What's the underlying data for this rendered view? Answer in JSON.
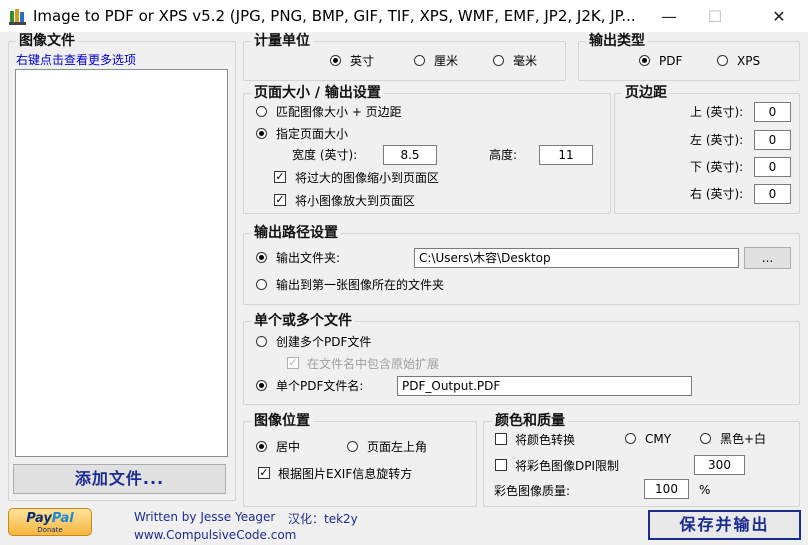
{
  "window": {
    "title": "Image to PDF or XPS  v5.2   (JPG, PNG, BMP, GIF, TIF, XPS, WMF, EMF, JP2, J2K, JP...",
    "minimize_glyph": "—",
    "maximize_glyph": "☐",
    "close_glyph": "✕"
  },
  "files": {
    "title": "图像文件",
    "hint": "右键点击查看更多选项",
    "add_button": "添加文件..."
  },
  "units": {
    "title": "计量单位",
    "options": [
      "英寸",
      "厘米",
      "毫米"
    ],
    "selected": 0
  },
  "output_type": {
    "title": "输出类型",
    "options": [
      "PDF",
      "XPS"
    ],
    "selected": 0
  },
  "page_size": {
    "title": "页面大小 / 输出设置",
    "opt_match": "匹配图像大小 + 页边距",
    "opt_specify": "指定页面大小",
    "width_label": "宽度 (英寸):",
    "width_value": "8.5",
    "height_label": "高度:",
    "height_value": "11",
    "shrink_label": "将过大的图像缩小到页面区",
    "shrink_checked": true,
    "enlarge_label": "将小图像放大到页面区",
    "enlarge_checked": true
  },
  "margins": {
    "title": "页边距",
    "top_label": "上 (英寸):",
    "top_value": "0",
    "left_label": "左 (英寸):",
    "left_value": "0",
    "bottom_label": "下 (英寸):",
    "bottom_value": "0",
    "right_label": "右 (英寸):",
    "right_value": "0"
  },
  "output_path": {
    "title": "输出路径设置",
    "folder_label": "输出文件夹:",
    "folder_value": "C:\\Users\\木容\\Desktop",
    "browse_label": "...",
    "first_image_label": "输出到第一张图像所在的文件夹"
  },
  "files_mode": {
    "title": "单个或多个文件",
    "multi_label": "创建多个PDF文件",
    "include_ext_label": "在文件名中包含原始扩展",
    "single_label": "单个PDF文件名:",
    "single_value": "PDF_Output.PDF"
  },
  "image_position": {
    "title": "图像位置",
    "center_label": "居中",
    "topleft_label": "页面左上角",
    "exif_label": "根据图片EXIF信息旋转方",
    "exif_checked": true
  },
  "color_quality": {
    "title": "颜色和质量",
    "convert_label": "将颜色转换",
    "cmy_label": "CMY",
    "bw_label": "黑色+白",
    "dpi_label": "将彩色图像DPI限制",
    "dpi_value": "300",
    "quality_label": "彩色图像质量:",
    "quality_value": "100",
    "quality_unit": "%"
  },
  "footer": {
    "paypal": "PayPal",
    "paypal_pay": "Pay",
    "paypal_pal": "Pal",
    "paypal_sub": "Donate",
    "author": "Written by Jesse Yeager",
    "localized": "汉化：tek2y",
    "website": "www.CompulsiveCode.com",
    "save_button": "保存并输出"
  },
  "colors": {
    "accent_text": "#1b2c8f",
    "hint_link": "#0000cc"
  }
}
